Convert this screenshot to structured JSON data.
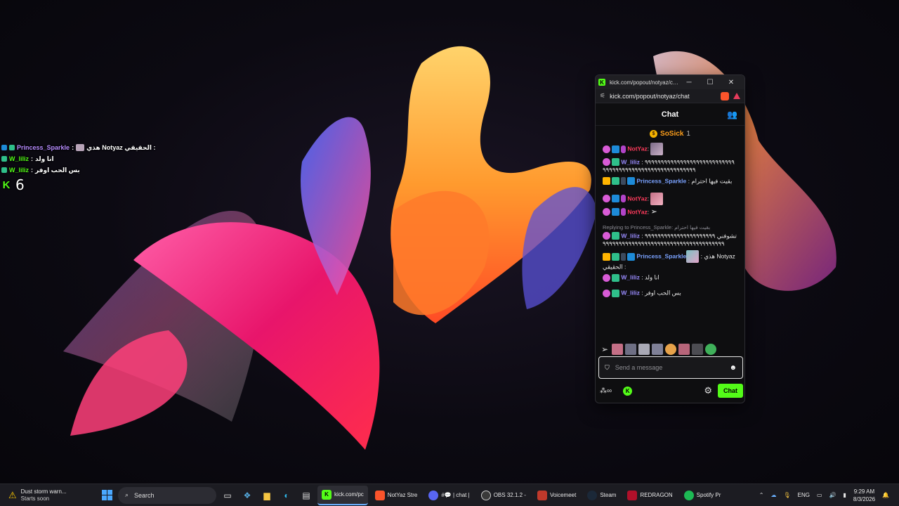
{
  "overlay": {
    "lines": [
      {
        "user": "Princess_Sparkle",
        "sep": " : ",
        "text": "هذي Notyaz الحقيقي :"
      },
      {
        "user": "W_liliz",
        "sep": " : ",
        "text": "انا ولد"
      },
      {
        "user": "W_liliz",
        "sep": " : ",
        "text": "بس الحب اوفر"
      }
    ],
    "viewer_count": "6"
  },
  "window": {
    "title": "kick.com/popout/notyaz/ch...",
    "url": "kick.com/popout/notyaz/chat"
  },
  "chat": {
    "header": "Chat",
    "pinned": {
      "user": "SoSick",
      "count": "1"
    },
    "messages": [
      {
        "user": "NotYaz",
        "color": "red",
        "text": ""
      },
      {
        "user": "W_liliz",
        "color": "purple",
        "text": ": ٩٩٩٩٩٩٩٩٩٩٩٩٩٩٩٩٩٩٩٩٩٩٩٩٩٩٩٩٩٩٩٩٩٩٩٩٩٩٩٩٩٩٩٩٩٩٩٩٩٩٩٩٩٩٩٩٩"
      },
      {
        "user": "Princess_Sparkle",
        "color": "blue",
        "text": ": بقيت فيها احترام"
      },
      {
        "user": "NotYaz",
        "color": "red",
        "text": ":"
      },
      {
        "user": "NotYaz",
        "color": "red",
        "text": ":"
      },
      {
        "user": "W_liliz",
        "color": "purple",
        "reply": "Replying to Princess_Sparkle: بقيت فيها احترام",
        "text": ": تشوفني ٩٩٩٩٩٩٩٩٩٩٩٩٩٩٩٩٩٩٩٩٩٩٩٩٩٩٩٩٩٩٩٩٩٩٩٩٩٩٩٩٩٩٩٩٩٩٩٩٩٩٩٩٩٩٩٩٩٩٩٩"
      },
      {
        "user": "Princess_Sparkle",
        "color": "blue",
        "text": ": هذي Notyaz الحقيقي :"
      },
      {
        "user": "W_liliz",
        "color": "purple",
        "text": ": انا ولد"
      },
      {
        "user": "W_liliz",
        "color": "purple",
        "text": ": بس الحب اوفر"
      }
    ],
    "input_placeholder": "Send a message",
    "send_label": "Chat"
  },
  "taskbar": {
    "weather_title": "Dust storm warn...",
    "weather_sub": "Starts soon",
    "search_label": "Search",
    "apps": [
      {
        "label": "kick.com/pc",
        "icon": "kick-icon",
        "color": "#53fc18"
      },
      {
        "label": "NotYaz Stre",
        "icon": "brave-icon",
        "color": "#fb542b"
      },
      {
        "label": "#💬 | chat |",
        "icon": "discord-icon",
        "color": "#5865f2"
      },
      {
        "label": "OBS 32.1.2 -",
        "icon": "obs-icon",
        "color": "#3a3a3a"
      },
      {
        "label": "Voicemeet",
        "icon": "voicemeeter-icon",
        "color": "#c0392b"
      },
      {
        "label": "Steam",
        "icon": "steam-icon",
        "color": "#1b2838"
      },
      {
        "label": "REDRAGON",
        "icon": "redragon-icon",
        "color": "#b0102a"
      },
      {
        "label": "Spotify Pr",
        "icon": "spotify-icon",
        "color": "#1db954"
      }
    ],
    "lang": "ENG",
    "time": "9:29 AM",
    "date": "8/3/2026"
  }
}
